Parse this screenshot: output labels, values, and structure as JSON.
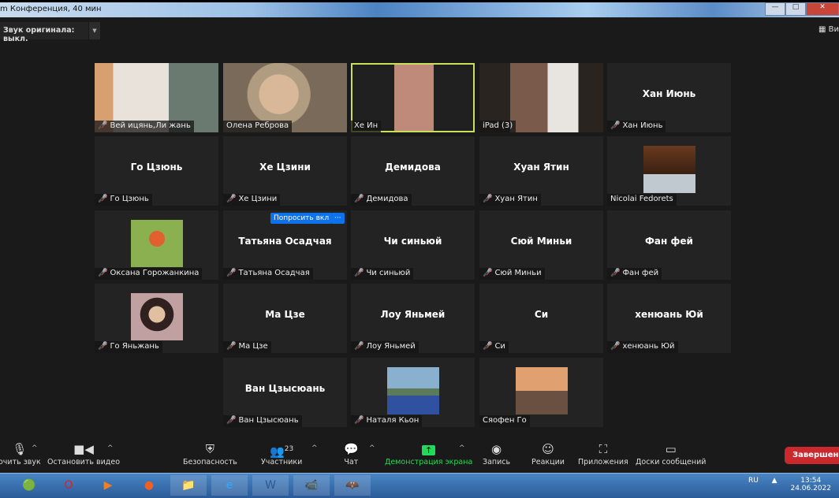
{
  "window": {
    "title": "m Конференция, 40 мин",
    "minimize": "—",
    "maximize": "□"
  },
  "audio": {
    "label": "Звук оригинала: выкл.",
    "dropdown_icon": "caret-down"
  },
  "view": {
    "label": "Ви"
  },
  "accent": {
    "active_speaker": "#c9e05a",
    "blue": "#0e72ed",
    "end": "#c9282d",
    "green": "#23d959",
    "muted": "#e0403a"
  },
  "tiles": [
    {
      "name": "Вей ицянь,Ли жань",
      "muted": true,
      "video": true,
      "bg": "linear-gradient(90deg,#d8a070 0 15%,#e8e2da 15% 60%,#6a7a70 60% 100%)"
    },
    {
      "name": "Олена Реброва",
      "muted": false,
      "video": true,
      "bg": "radial-gradient(circle at 45% 45%,#d9b89a 0 25%,#b09c80 26% 40%,#7a6a5a 41%)"
    },
    {
      "name": "Хе Ин",
      "muted": false,
      "video": true,
      "active": true,
      "bg": "linear-gradient(90deg,#202020 0 35%,#c08a7a 35% 67%,#202020 67%)"
    },
    {
      "name": "iPad (3)",
      "muted": false,
      "video": true,
      "bg": "linear-gradient(90deg,#2a2420 0 25%,#7a5a4a 25% 55%,#e8e4e0 55% 80%,#2a2420 80%)"
    },
    {
      "name": "Хан Июнь",
      "muted": true,
      "center": "Хан Июнь"
    },
    {
      "name": "Го Цзюнь",
      "muted": true,
      "center": "Го Цзюнь"
    },
    {
      "name": "Хе Цзини",
      "muted": true,
      "center": "Хе Цзини"
    },
    {
      "name": "Демидова",
      "muted": true,
      "center": "Демидова"
    },
    {
      "name": "Хуан Ятин",
      "muted": true,
      "center": "Хуан Ятин"
    },
    {
      "name": "Nicolai Fedorets",
      "muted": false,
      "photo": "linear-gradient(180deg,#6a3a20,#3a2010 60%,#c0c8d0 60%)"
    },
    {
      "name": "Оксана Горожанкина",
      "muted": true,
      "photo": "radial-gradient(circle at 50% 40%,#e06030 0 20%,#8ab050 21%)"
    },
    {
      "name": "Татьяна Осадчая",
      "muted": true,
      "center": "Татьяна Осадчая"
    },
    {
      "name": "Чи синьюй",
      "muted": true,
      "center": "Чи синьюй"
    },
    {
      "name": "Сюй Миньи",
      "muted": true,
      "center": "Сюй Миньи"
    },
    {
      "name": "Фан  фей",
      "muted": true,
      "center": "Фан  фей"
    },
    {
      "name": "Го Яньжань",
      "muted": true,
      "photo": "radial-gradient(circle at 50% 45%,#e0c0a0 0 22%,#302020 23% 45%,#c0a0a0 46%)"
    },
    {
      "name": "Ма Цзе",
      "muted": true,
      "center": "Ма Цзе"
    },
    {
      "name": "Лоу Яньмей",
      "muted": true,
      "center": "Лоу Яньмей"
    },
    {
      "name": "Си",
      "muted": true,
      "center": "Си"
    },
    {
      "name": "хенюань Юй",
      "muted": true,
      "center": "хенюань Юй"
    },
    {
      "name": "Ван Цзысюань",
      "muted": true,
      "center": "Ван Цзысюань"
    },
    {
      "name": "Наталя Кьон",
      "muted": true,
      "photo": "linear-gradient(180deg,#8ab0d0 0 45%,#5a7a5a 45% 60%,#3050a0 60%)"
    },
    {
      "name": "Сяофен Го",
      "muted": false,
      "photo": "linear-gradient(180deg,#e0a070 0 50%,#6a5040 50%)"
    }
  ],
  "hover": {
    "ask": "Попросить вкл",
    "more": "···"
  },
  "toolbar": {
    "mute": "очить звук",
    "video": "Остановить видео",
    "security": "Безопасность",
    "participants": "Участники",
    "participants_count": "23",
    "chat": "Чат",
    "share": "Демонстрация экрана",
    "record": "Запись",
    "reactions": "Реакции",
    "apps": "Приложения",
    "whiteboards": "Доски сообщений",
    "end": "Завершение"
  },
  "tray": {
    "lang": "RU",
    "time": "13:54",
    "date": "24.06.2022"
  }
}
